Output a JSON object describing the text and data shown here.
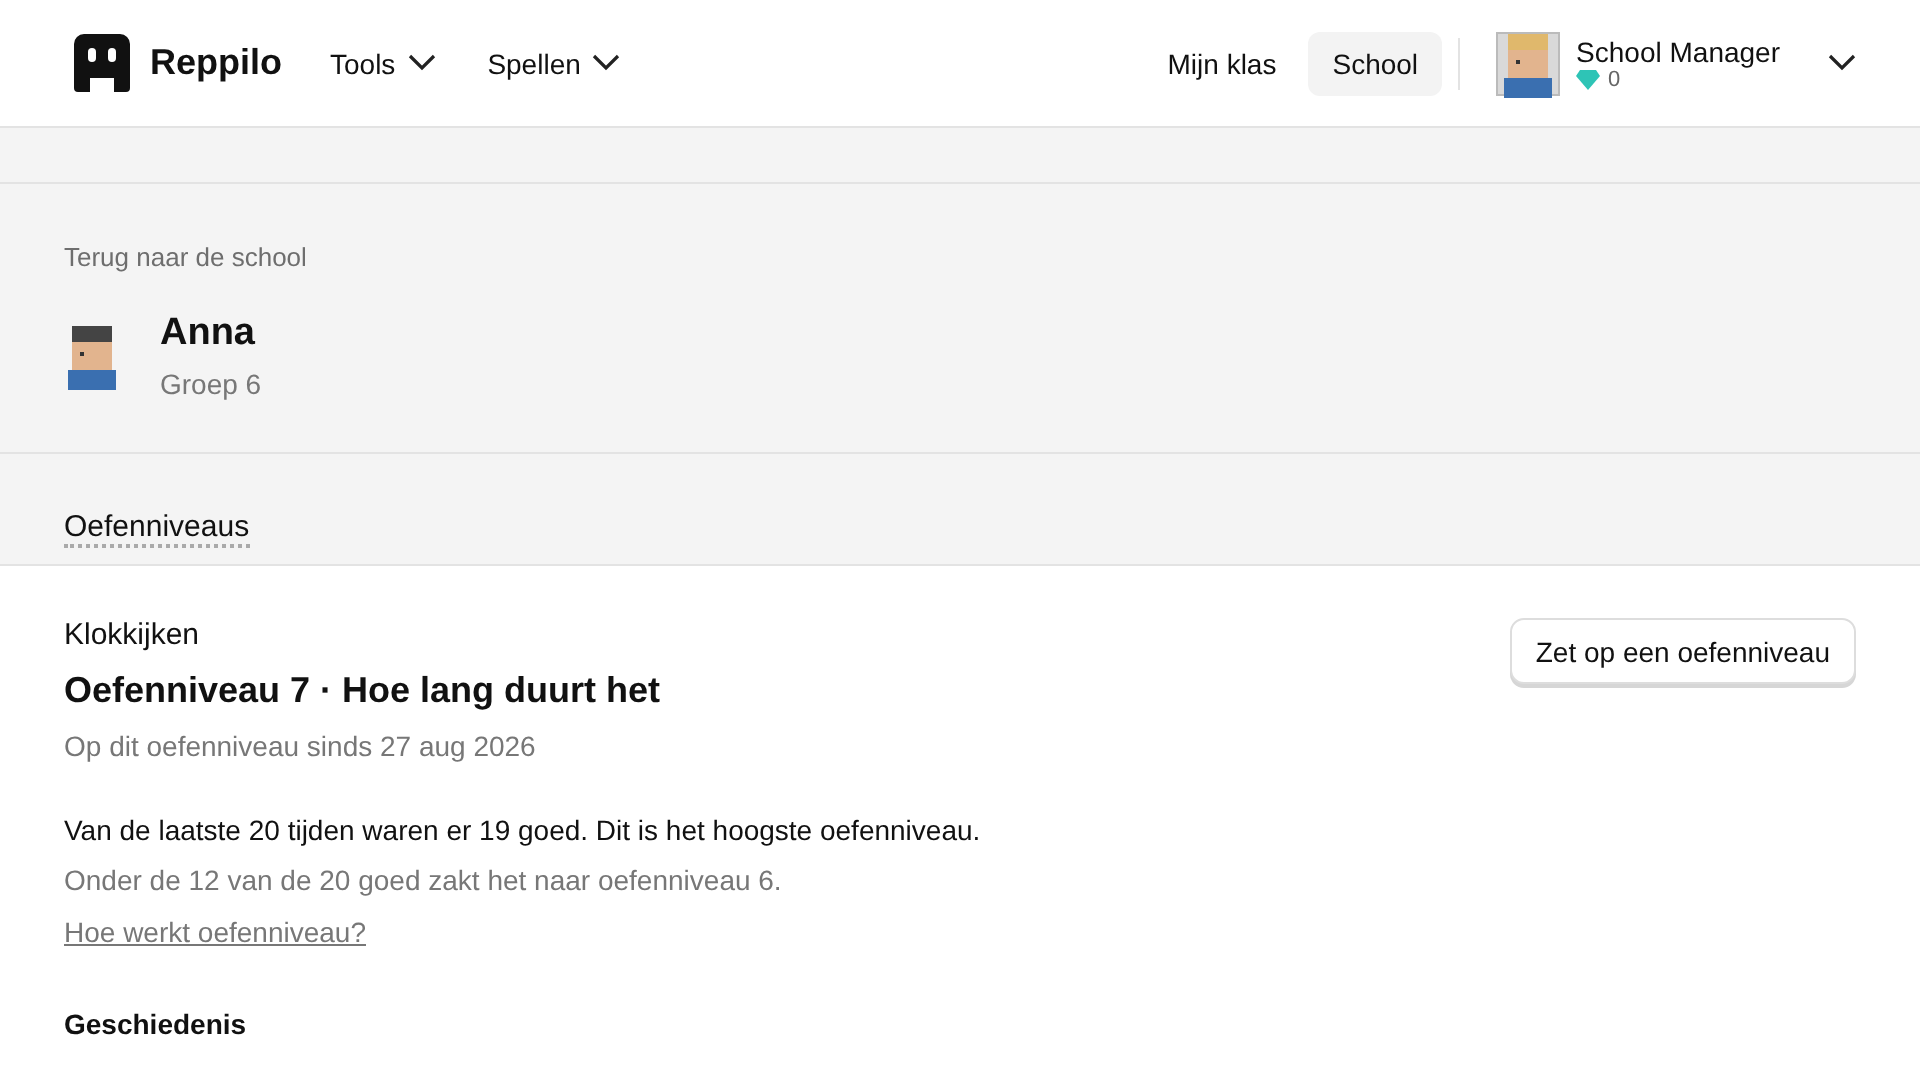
{
  "header": {
    "brand": "Reppilo",
    "menus": [
      {
        "label": "Tools"
      },
      {
        "label": "Spellen"
      }
    ],
    "nav": [
      {
        "label": "Mijn klas",
        "selected": false
      },
      {
        "label": "School",
        "selected": true
      }
    ],
    "user": {
      "name": "School Manager",
      "gems": "0"
    }
  },
  "back_link": "Terug naar de school",
  "student": {
    "name": "Anna",
    "group": "Groep 6"
  },
  "tabs": [
    {
      "label": "Oefenniveaus",
      "selected": true
    }
  ],
  "skill": {
    "category": "Klokkijken",
    "title": "Oefenniveau 7 · Hoe lang duurt het",
    "since": "Op dit oefenniveau sinds 27 aug 2026",
    "button": "Zet op een oefenniveau",
    "summary": "Van de laatste 20 tijden waren er 19 goed. Dit is het hoogste oefenniveau.",
    "rule": "Onder de 12 van de 20 goed zakt het naar oefenniveau 6.",
    "help_link": "Hoe werkt oefenniveau?",
    "history_title": "Geschiedenis"
  }
}
